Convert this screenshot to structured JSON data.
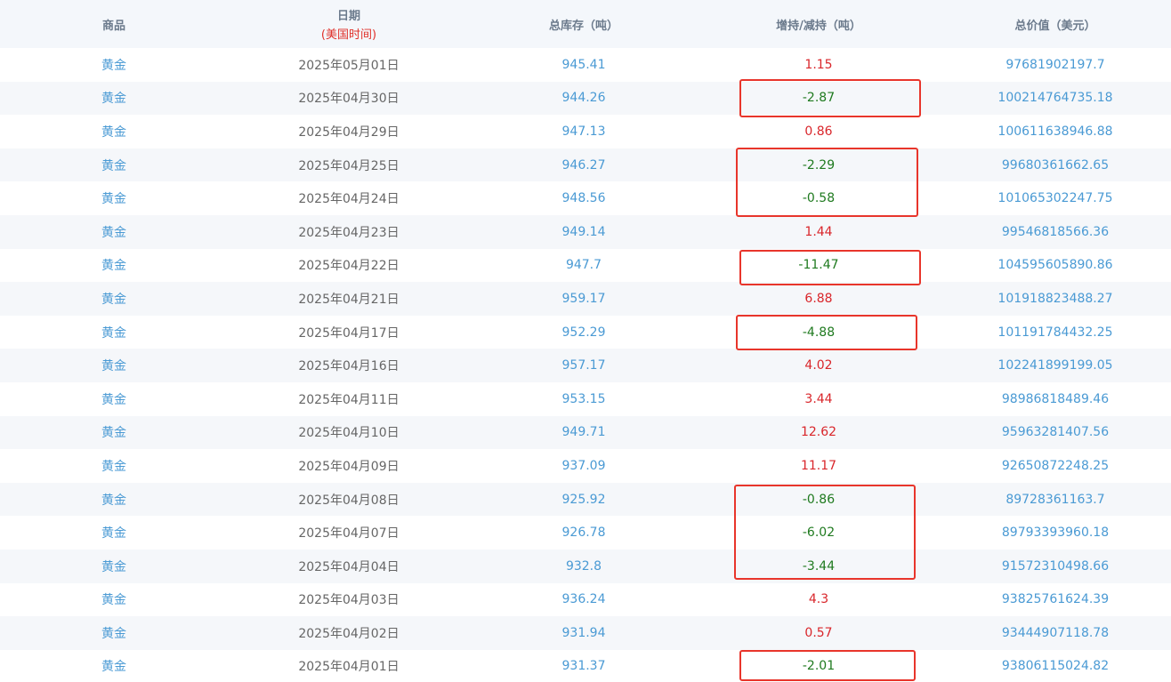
{
  "table": {
    "headers": {
      "product": "商品",
      "date": "日期",
      "date_note": "(美国时间)",
      "total": "总库存（吨）",
      "change": "增持/减持（吨）",
      "value": "总价值（美元）"
    },
    "rows": [
      {
        "product": "黄金",
        "date": "2025年05月01日",
        "total": "945.41",
        "change": "1.15",
        "value": "97681902197.7",
        "direction": "up"
      },
      {
        "product": "黄金",
        "date": "2025年04月30日",
        "total": "944.26",
        "change": "-2.87",
        "value": "100214764735.18",
        "direction": "down"
      },
      {
        "product": "黄金",
        "date": "2025年04月29日",
        "total": "947.13",
        "change": "0.86",
        "value": "100611638946.88",
        "direction": "up"
      },
      {
        "product": "黄金",
        "date": "2025年04月25日",
        "total": "946.27",
        "change": "-2.29",
        "value": "99680361662.65",
        "direction": "down"
      },
      {
        "product": "黄金",
        "date": "2025年04月24日",
        "total": "948.56",
        "change": "-0.58",
        "value": "101065302247.75",
        "direction": "down"
      },
      {
        "product": "黄金",
        "date": "2025年04月23日",
        "total": "949.14",
        "change": "1.44",
        "value": "99546818566.36",
        "direction": "up"
      },
      {
        "product": "黄金",
        "date": "2025年04月22日",
        "total": "947.7",
        "change": "-11.47",
        "value": "104595605890.86",
        "direction": "down"
      },
      {
        "product": "黄金",
        "date": "2025年04月21日",
        "total": "959.17",
        "change": "6.88",
        "value": "101918823488.27",
        "direction": "up"
      },
      {
        "product": "黄金",
        "date": "2025年04月17日",
        "total": "952.29",
        "change": "-4.88",
        "value": "101191784432.25",
        "direction": "down"
      },
      {
        "product": "黄金",
        "date": "2025年04月16日",
        "total": "957.17",
        "change": "4.02",
        "value": "102241899199.05",
        "direction": "up"
      },
      {
        "product": "黄金",
        "date": "2025年04月11日",
        "total": "953.15",
        "change": "3.44",
        "value": "98986818489.46",
        "direction": "up"
      },
      {
        "product": "黄金",
        "date": "2025年04月10日",
        "total": "949.71",
        "change": "12.62",
        "value": "95963281407.56",
        "direction": "up"
      },
      {
        "product": "黄金",
        "date": "2025年04月09日",
        "total": "937.09",
        "change": "11.17",
        "value": "92650872248.25",
        "direction": "up"
      },
      {
        "product": "黄金",
        "date": "2025年04月08日",
        "total": "925.92",
        "change": "-0.86",
        "value": "89728361163.7",
        "direction": "down"
      },
      {
        "product": "黄金",
        "date": "2025年04月07日",
        "total": "926.78",
        "change": "-6.02",
        "value": "89793393960.18",
        "direction": "down"
      },
      {
        "product": "黄金",
        "date": "2025年04月04日",
        "total": "932.8",
        "change": "-3.44",
        "value": "91572310498.66",
        "direction": "down"
      },
      {
        "product": "黄金",
        "date": "2025年04月03日",
        "total": "936.24",
        "change": "4.3",
        "value": "93825761624.39",
        "direction": "up"
      },
      {
        "product": "黄金",
        "date": "2025年04月02日",
        "total": "931.94",
        "change": "0.57",
        "value": "93444907118.78",
        "direction": "up"
      },
      {
        "product": "黄金",
        "date": "2025年04月01日",
        "total": "931.37",
        "change": "-2.01",
        "value": "93806115024.82",
        "direction": "down"
      }
    ]
  },
  "colors": {
    "increase": "#d9262b",
    "decrease": "#1f7a1f",
    "link": "#4a9ad4",
    "highlight_box": "#e8352b",
    "header_bg": "#f4f7fb"
  }
}
